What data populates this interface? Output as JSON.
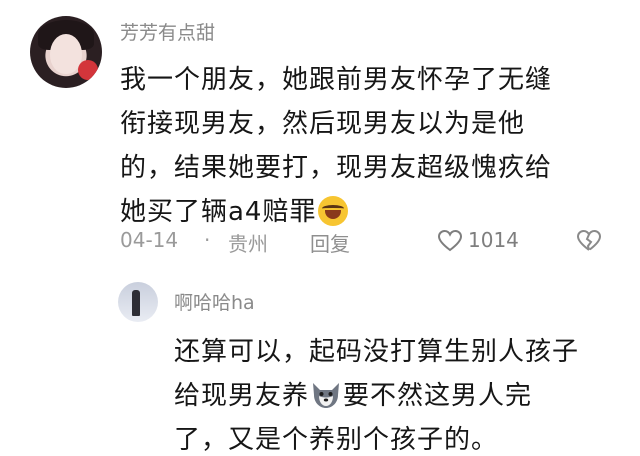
{
  "main_comment": {
    "username": "芳芳有点甜",
    "lines": [
      "我一个朋友，她跟前男友怀孕了无缝",
      "衔接现男友，然后现男友以为是他",
      "的，结果她要打，现男友超级愧疚给",
      "她买了辆a4赔罪"
    ],
    "emoji_icon": "laughing-crying-emoji-icon",
    "date": "04-14",
    "separator": "·",
    "location": "贵州",
    "reply_label": "回复",
    "likes": "1014"
  },
  "reply_comment": {
    "username": "啊哈哈ha",
    "line1": "还算可以，起码没打算生别人孩子",
    "line2_before": "给现男友养",
    "line2_after": "要不然这男人完",
    "line3": "了，又是个养别个孩子的。",
    "emoji_icon": "husky-dog-emoji-icon"
  },
  "colors": {
    "text_primary": "#161616",
    "text_secondary": "#8a8a8a",
    "background": "#ffffff"
  }
}
